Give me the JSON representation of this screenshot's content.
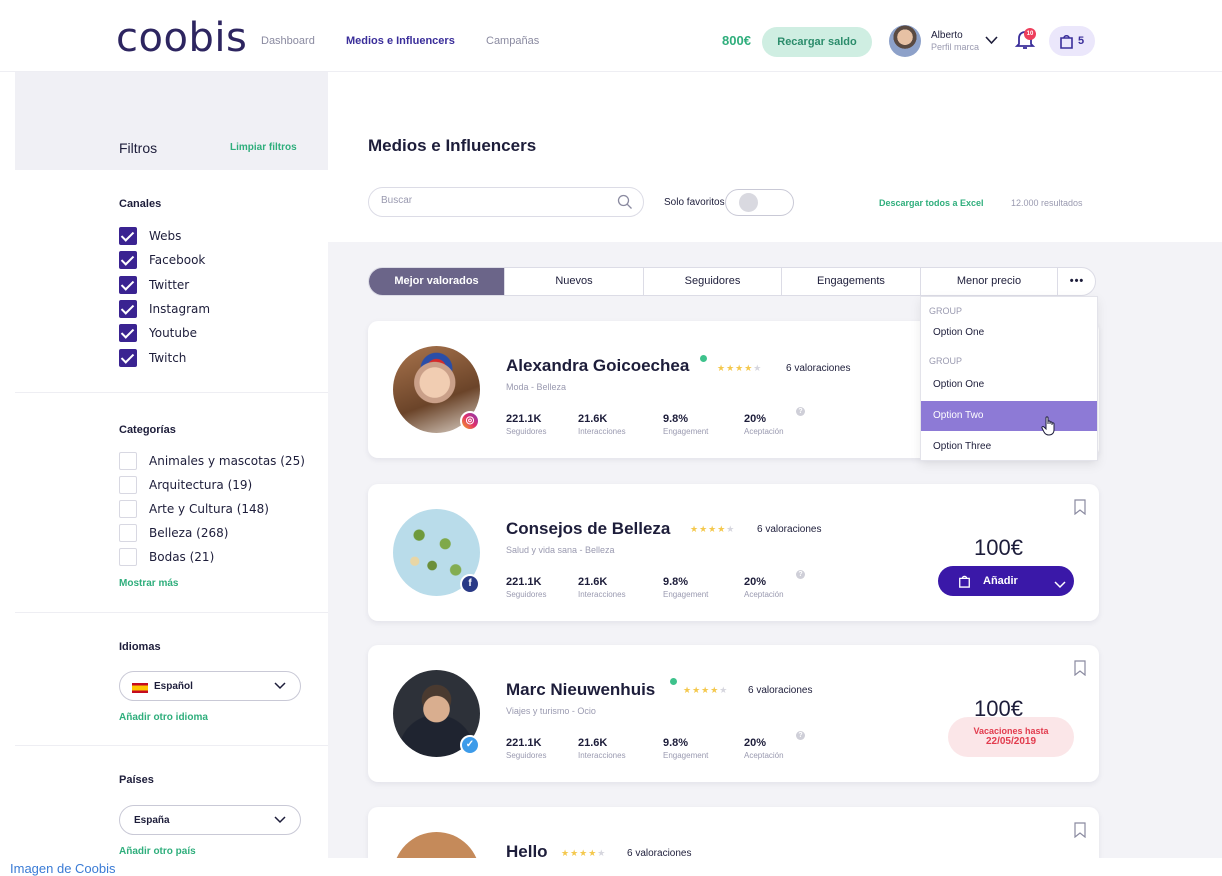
{
  "topbar": {
    "logo": "coobis",
    "nav": [
      {
        "label": "Dashboard",
        "active": false
      },
      {
        "label": "Medios e Influencers",
        "active": true
      },
      {
        "label": "Campañas",
        "active": false
      }
    ],
    "balance": "800€",
    "recharge_label": "Recargar saldo",
    "user_name": "Alberto",
    "user_role": "Perfil marca",
    "notifications_count": "10",
    "cart_count": "5"
  },
  "sidebar": {
    "title": "Filtros",
    "clear_label": "Limpiar filtros",
    "channels": {
      "title": "Canales",
      "items": [
        {
          "label": "Webs",
          "checked": true
        },
        {
          "label": "Facebook",
          "checked": true
        },
        {
          "label": "Twitter",
          "checked": true
        },
        {
          "label": "Instagram",
          "checked": true
        },
        {
          "label": "Youtube",
          "checked": true
        },
        {
          "label": "Twitch",
          "checked": true
        }
      ]
    },
    "categories": {
      "title": "Categorías",
      "items": [
        {
          "label": "Animales y mascotas (25)",
          "checked": false
        },
        {
          "label": "Arquitectura (19)",
          "checked": false
        },
        {
          "label": "Arte y Cultura (148)",
          "checked": false
        },
        {
          "label": "Belleza (268)",
          "checked": false
        },
        {
          "label": "Bodas (21)",
          "checked": false
        }
      ],
      "more_label": "Mostrar más"
    },
    "languages": {
      "title": "Idiomas",
      "selected": "Español",
      "add_label": "Añadir otro idioma"
    },
    "countries": {
      "title": "Países",
      "selected": "España",
      "add_label": "Añadir otro país"
    }
  },
  "main": {
    "title": "Medios e Influencers",
    "search_placeholder": "Buscar",
    "favorites_label": "Solo favoritos",
    "favorites_on": false,
    "excel_label": "Descargar todos a Excel",
    "results_label": "12.000 resultados",
    "tabs": [
      {
        "label": "Mejor valorados",
        "active": true
      },
      {
        "label": "Nuevos",
        "active": false
      },
      {
        "label": "Seguidores",
        "active": false
      },
      {
        "label": "Engagements",
        "active": false
      },
      {
        "label": "Menor precio",
        "active": false
      },
      {
        "label": "•••",
        "active": false
      }
    ],
    "dropdown": {
      "groups": [
        {
          "label": "GROUP",
          "options": [
            "Option One"
          ]
        },
        {
          "label": "GROUP",
          "options": [
            "Option One",
            "Option Two",
            "Option Three"
          ]
        }
      ],
      "highlighted": "Option Two"
    }
  },
  "cards": [
    {
      "name": "Alexandra Goicoechea",
      "verified": true,
      "rating": 4,
      "ratings_label": "6 valoraciones",
      "category": "Moda - Belleza",
      "network": "instagram",
      "stats": [
        {
          "value": "221.1K",
          "label": "Seguidores"
        },
        {
          "value": "21.6K",
          "label": "Interacciones"
        },
        {
          "value": "9.8%",
          "label": "Engagement"
        },
        {
          "value": "20%",
          "label": "Aceptación"
        }
      ]
    },
    {
      "name": "Consejos de Belleza",
      "verified": false,
      "rating": 4,
      "ratings_label": "6 valoraciones",
      "category": "Salud y vida sana - Belleza",
      "network": "facebook",
      "price": "100€",
      "add_label": "Añadir",
      "stats": [
        {
          "value": "221.1K",
          "label": "Seguidores"
        },
        {
          "value": "21.6K",
          "label": "Interacciones"
        },
        {
          "value": "9.8%",
          "label": "Engagement"
        },
        {
          "value": "20%",
          "label": "Aceptación"
        }
      ]
    },
    {
      "name": "Marc Nieuwenhuis",
      "verified": true,
      "rating": 4,
      "ratings_label": "6 valoraciones",
      "category": "Viajes y turismo - Ocio",
      "network": "twitter",
      "price": "100€",
      "vacation_line1": "Vacaciones hasta",
      "vacation_line2": "22/05/2019",
      "stats": [
        {
          "value": "221.1K",
          "label": "Seguidores"
        },
        {
          "value": "21.6K",
          "label": "Interacciones"
        },
        {
          "value": "9.8%",
          "label": "Engagement"
        },
        {
          "value": "20%",
          "label": "Aceptación"
        }
      ]
    },
    {
      "name": "Hello",
      "rating": 4,
      "ratings_label": "6 valoraciones"
    }
  ],
  "footer_link": "Imagen de Coobis",
  "colors": {
    "brand_purple": "#3a18a8",
    "green": "#2fae7c",
    "active_tab": "#6b6589",
    "highlight": "#8d7ad6"
  }
}
